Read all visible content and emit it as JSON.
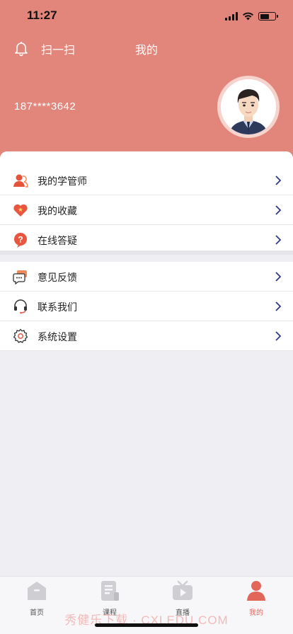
{
  "status_bar": {
    "time": "11:27"
  },
  "header": {
    "scan_label": "扫一扫",
    "title": "我的",
    "phone": "187****3642",
    "bg_color": "#e2857a"
  },
  "menu_group_1": [
    {
      "label": "我的学管师",
      "icon": "tutor-icon"
    },
    {
      "label": "我的收藏",
      "icon": "heart-icon"
    },
    {
      "label": "在线答疑",
      "icon": "question-icon"
    }
  ],
  "menu_group_2": [
    {
      "label": "意见反馈",
      "icon": "feedback-icon"
    },
    {
      "label": "联系我们",
      "icon": "headset-icon"
    },
    {
      "label": "系统设置",
      "icon": "settings-icon"
    }
  ],
  "tabs": [
    {
      "label": "首页",
      "icon": "home-icon",
      "active": false
    },
    {
      "label": "课程",
      "icon": "course-icon",
      "active": false
    },
    {
      "label": "直播",
      "icon": "live-icon",
      "active": false
    },
    {
      "label": "我的",
      "icon": "profile-icon",
      "active": true
    }
  ],
  "watermark": "秀健乐下载 · CXLEDU.COM",
  "accent_color": "#e2675a",
  "chevron_color": "#2c3a8c"
}
